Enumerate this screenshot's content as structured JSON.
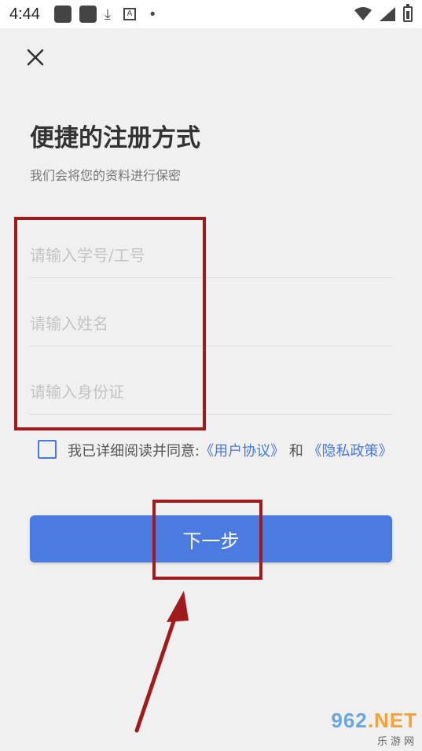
{
  "status_bar": {
    "time": "4:44",
    "icons": [
      "app-square-icon",
      "app-square-icon",
      "download-icon",
      "a-icon",
      "dot-icon",
      "wifi-icon",
      "signal-icon",
      "battery-icon"
    ]
  },
  "header": {
    "close_icon": "close-icon"
  },
  "main": {
    "title": "便捷的注册方式",
    "subtitle": "我们会将您的资料进行保密",
    "fields": [
      {
        "placeholder": "请输入学号/工号",
        "value": ""
      },
      {
        "placeholder": "请输入姓名",
        "value": ""
      },
      {
        "placeholder": "请输入身份证",
        "value": ""
      }
    ],
    "agreement": {
      "prefix": "我已详细阅读并同意:",
      "user_agreement": "《用户协议》",
      "and": "和",
      "privacy_policy": "《隐私政策》",
      "checked": false
    },
    "next_button": "下一步"
  },
  "watermark": {
    "main_num": "962",
    "main_dot": ".NET",
    "sub": "乐游网"
  },
  "colors": {
    "accent": "#4b7be0",
    "link": "#4a78d8",
    "annotation": "#a01c1c",
    "background": "#f0f0f0"
  }
}
